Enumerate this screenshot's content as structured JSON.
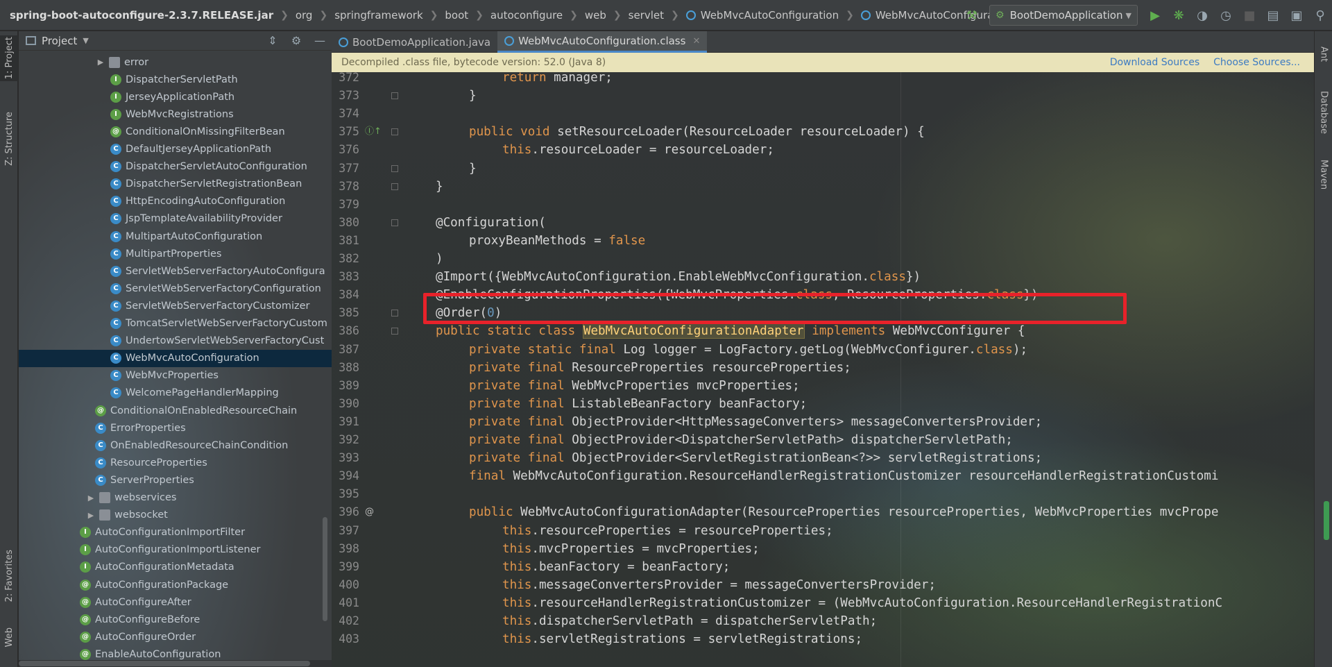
{
  "breadcrumbs": [
    "spring-boot-autoconfigure-2.3.7.RELEASE.jar",
    "org",
    "springframework",
    "boot",
    "autoconfigure",
    "web",
    "servlet",
    "WebMvcAutoConfiguration",
    "WebMvcAutoConfigurationAdapter"
  ],
  "toolbar": {
    "run_config": "BootDemoApplication",
    "icons": [
      "hammer-icon",
      "run-icon",
      "debug-icon",
      "coverage-icon",
      "profile-icon",
      "stop-icon",
      "project-structure-icon",
      "layout-icon",
      "search-icon"
    ]
  },
  "left_strip": {
    "project": "1: Project",
    "structure": "Z: Structure",
    "favorites": "2: Favorites",
    "web": "Web"
  },
  "right_strip": {
    "ant": "Ant",
    "database": "Database",
    "maven": "Maven"
  },
  "project_panel": {
    "title": "Project",
    "rows": [
      {
        "label": "error",
        "kind": "folder",
        "indent": 1,
        "expandable": true
      },
      {
        "label": "DispatcherServletPath",
        "kind": "I",
        "indent": 2
      },
      {
        "label": "JerseyApplicationPath",
        "kind": "I",
        "indent": 2
      },
      {
        "label": "WebMvcRegistrations",
        "kind": "I",
        "indent": 2
      },
      {
        "label": "ConditionalOnMissingFilterBean",
        "kind": "@",
        "indent": 2
      },
      {
        "label": "DefaultJerseyApplicationPath",
        "kind": "C",
        "indent": 2
      },
      {
        "label": "DispatcherServletAutoConfiguration",
        "kind": "C",
        "indent": 2
      },
      {
        "label": "DispatcherServletRegistrationBean",
        "kind": "C",
        "indent": 2
      },
      {
        "label": "HttpEncodingAutoConfiguration",
        "kind": "C",
        "indent": 2
      },
      {
        "label": "JspTemplateAvailabilityProvider",
        "kind": "C",
        "indent": 2
      },
      {
        "label": "MultipartAutoConfiguration",
        "kind": "C",
        "indent": 2
      },
      {
        "label": "MultipartProperties",
        "kind": "C",
        "indent": 2
      },
      {
        "label": "ServletWebServerFactoryAutoConfigura",
        "kind": "C",
        "indent": 2
      },
      {
        "label": "ServletWebServerFactoryConfiguration",
        "kind": "C",
        "indent": 2
      },
      {
        "label": "ServletWebServerFactoryCustomizer",
        "kind": "C",
        "indent": 2
      },
      {
        "label": "TomcatServletWebServerFactoryCustom",
        "kind": "C",
        "indent": 2
      },
      {
        "label": "UndertowServletWebServerFactoryCust",
        "kind": "C",
        "indent": 2
      },
      {
        "label": "WebMvcAutoConfiguration",
        "kind": "C",
        "indent": 2,
        "selected": true
      },
      {
        "label": "WebMvcProperties",
        "kind": "C",
        "indent": 2
      },
      {
        "label": "WelcomePageHandlerMapping",
        "kind": "C",
        "indent": 2
      },
      {
        "label": "ConditionalOnEnabledResourceChain",
        "kind": "@",
        "indent": 1
      },
      {
        "label": "ErrorProperties",
        "kind": "C",
        "indent": 1
      },
      {
        "label": "OnEnabledResourceChainCondition",
        "kind": "C",
        "indent": 1
      },
      {
        "label": "ResourceProperties",
        "kind": "C",
        "indent": 1
      },
      {
        "label": "ServerProperties",
        "kind": "C",
        "indent": 1
      },
      {
        "label": "webservices",
        "kind": "folder",
        "indent": 0,
        "expandable": true
      },
      {
        "label": "websocket",
        "kind": "folder",
        "indent": 0,
        "expandable": true
      },
      {
        "label": "AutoConfigurationImportFilter",
        "kind": "I",
        "indent": 0
      },
      {
        "label": "AutoConfigurationImportListener",
        "kind": "I",
        "indent": 0
      },
      {
        "label": "AutoConfigurationMetadata",
        "kind": "I",
        "indent": 0
      },
      {
        "label": "AutoConfigurationPackage",
        "kind": "@",
        "indent": 0
      },
      {
        "label": "AutoConfigureAfter",
        "kind": "@",
        "indent": 0
      },
      {
        "label": "AutoConfigureBefore",
        "kind": "@",
        "indent": 0
      },
      {
        "label": "AutoConfigureOrder",
        "kind": "@",
        "indent": 0
      },
      {
        "label": "EnableAutoConfiguration",
        "kind": "@",
        "indent": 0
      }
    ]
  },
  "tabs": [
    {
      "label": "BootDemoApplication.java",
      "active": false
    },
    {
      "label": "WebMvcAutoConfiguration.class",
      "active": true
    }
  ],
  "banner": {
    "text": "Decompiled .class file, bytecode version: 52.0 (Java 8)",
    "download": "Download Sources",
    "choose": "Choose Sources..."
  },
  "code_lines": [
    {
      "n": "372",
      "indent": 2,
      "code": [
        [
          "kw",
          "return"
        ],
        [
          "t",
          " manager;"
        ]
      ]
    },
    {
      "n": "373",
      "indent": 1,
      "code": [
        [
          "t",
          "}"
        ]
      ]
    },
    {
      "n": "374",
      "indent": 0,
      "code": []
    },
    {
      "n": "375",
      "indent": 1,
      "marker": "override",
      "code": [
        [
          "kw",
          "public void"
        ],
        [
          "t",
          " setResourceLoader(ResourceLoader resourceLoader) {"
        ]
      ]
    },
    {
      "n": "376",
      "indent": 2,
      "code": [
        [
          "kw",
          "this"
        ],
        [
          "t",
          ".resourceLoader = resourceLoader;"
        ]
      ]
    },
    {
      "n": "377",
      "indent": 1,
      "code": [
        [
          "t",
          "}"
        ]
      ]
    },
    {
      "n": "378",
      "indent": 0,
      "code": [
        [
          "t",
          "}"
        ]
      ]
    },
    {
      "n": "379",
      "indent": 0,
      "code": []
    },
    {
      "n": "380",
      "indent": 0,
      "code": [
        [
          "t",
          "@Configuration("
        ]
      ]
    },
    {
      "n": "381",
      "indent": 1,
      "code": [
        [
          "t",
          "proxyBeanMethods = "
        ],
        [
          "kw",
          "false"
        ]
      ]
    },
    {
      "n": "382",
      "indent": 0,
      "code": [
        [
          "t",
          ")"
        ]
      ]
    },
    {
      "n": "383",
      "indent": 0,
      "code": [
        [
          "t",
          "@Import({WebMvcAutoConfiguration.EnableWebMvcConfiguration."
        ],
        [
          "kw",
          "class"
        ],
        [
          "t",
          "})"
        ]
      ]
    },
    {
      "n": "384",
      "indent": 0,
      "code": [
        [
          "t",
          "@EnableConfigurationProperties({WebMvcProperties."
        ],
        [
          "kw",
          "class"
        ],
        [
          "t",
          ", ResourceProperties."
        ],
        [
          "kw",
          "class"
        ],
        [
          "t",
          "})"
        ]
      ]
    },
    {
      "n": "385",
      "indent": 0,
      "code": [
        [
          "t",
          "@Order("
        ],
        [
          "num",
          "0"
        ],
        [
          "t",
          ")"
        ]
      ]
    },
    {
      "n": "386",
      "indent": 0,
      "code": [
        [
          "kw",
          "public static class"
        ],
        [
          "t",
          " "
        ],
        [
          "hl",
          "WebMvcAutoConfigurationAdapter"
        ],
        [
          "t",
          " "
        ],
        [
          "kw",
          "implements"
        ],
        [
          "t",
          " WebMvcConfigurer {"
        ]
      ]
    },
    {
      "n": "387",
      "indent": 1,
      "code": [
        [
          "kw",
          "private static final"
        ],
        [
          "t",
          " Log logger = LogFactory.getLog(WebMvcConfigurer."
        ],
        [
          "kw",
          "class"
        ],
        [
          "t",
          ");"
        ]
      ]
    },
    {
      "n": "388",
      "indent": 1,
      "code": [
        [
          "kw",
          "private final"
        ],
        [
          "t",
          " ResourceProperties resourceProperties;"
        ]
      ]
    },
    {
      "n": "389",
      "indent": 1,
      "code": [
        [
          "kw",
          "private final"
        ],
        [
          "t",
          " WebMvcProperties mvcProperties;"
        ]
      ]
    },
    {
      "n": "390",
      "indent": 1,
      "code": [
        [
          "kw",
          "private final"
        ],
        [
          "t",
          " ListableBeanFactory beanFactory;"
        ]
      ]
    },
    {
      "n": "391",
      "indent": 1,
      "code": [
        [
          "kw",
          "private final"
        ],
        [
          "t",
          " ObjectProvider<HttpMessageConverters> messageConvertersProvider;"
        ]
      ]
    },
    {
      "n": "392",
      "indent": 1,
      "code": [
        [
          "kw",
          "private final"
        ],
        [
          "t",
          " ObjectProvider<DispatcherServletPath> dispatcherServletPath;"
        ]
      ]
    },
    {
      "n": "393",
      "indent": 1,
      "code": [
        [
          "kw",
          "private final"
        ],
        [
          "t",
          " ObjectProvider<ServletRegistrationBean<?>> servletRegistrations;"
        ]
      ]
    },
    {
      "n": "394",
      "indent": 1,
      "code": [
        [
          "kw",
          "final"
        ],
        [
          "t",
          " WebMvcAutoConfiguration.ResourceHandlerRegistrationCustomizer resourceHandlerRegistrationCustomi"
        ]
      ]
    },
    {
      "n": "395",
      "indent": 0,
      "code": []
    },
    {
      "n": "396",
      "indent": 1,
      "marker": "at",
      "code": [
        [
          "kw",
          "public"
        ],
        [
          "t",
          " WebMvcAutoConfigurationAdapter(ResourceProperties resourceProperties, WebMvcProperties mvcPrope"
        ]
      ]
    },
    {
      "n": "397",
      "indent": 2,
      "code": [
        [
          "kw",
          "this"
        ],
        [
          "t",
          ".resourceProperties = resourceProperties;"
        ]
      ]
    },
    {
      "n": "398",
      "indent": 2,
      "code": [
        [
          "kw",
          "this"
        ],
        [
          "t",
          ".mvcProperties = mvcProperties;"
        ]
      ]
    },
    {
      "n": "399",
      "indent": 2,
      "code": [
        [
          "kw",
          "this"
        ],
        [
          "t",
          ".beanFactory = beanFactory;"
        ]
      ]
    },
    {
      "n": "400",
      "indent": 2,
      "code": [
        [
          "kw",
          "this"
        ],
        [
          "t",
          ".messageConvertersProvider = messageConvertersProvider;"
        ]
      ]
    },
    {
      "n": "401",
      "indent": 2,
      "code": [
        [
          "kw",
          "this"
        ],
        [
          "t",
          ".resourceHandlerRegistrationCustomizer = (WebMvcAutoConfiguration.ResourceHandlerRegistrationC"
        ]
      ]
    },
    {
      "n": "402",
      "indent": 2,
      "code": [
        [
          "kw",
          "this"
        ],
        [
          "t",
          ".dispatcherServletPath = dispatcherServletPath;"
        ]
      ]
    },
    {
      "n": "403",
      "indent": 2,
      "code": [
        [
          "kw",
          "this"
        ],
        [
          "t",
          ".servletRegistrations = servletRegistrations;"
        ]
      ]
    }
  ],
  "colors": {
    "accent": "#4a88c7",
    "keyword": "#e0954c",
    "highlight_box": "#e8222a",
    "banner": "#e9e3b9",
    "selection": "#0d293e"
  }
}
